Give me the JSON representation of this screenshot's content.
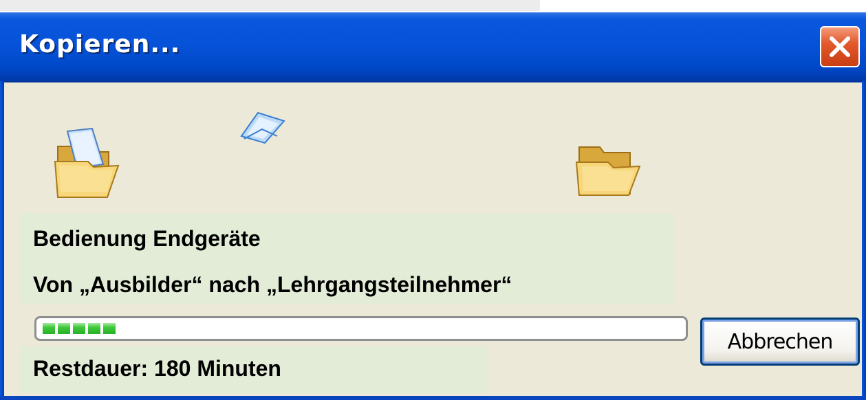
{
  "window": {
    "title": "Kopieren...",
    "close_icon": "close-icon"
  },
  "animation": {
    "source_icon": "open-folder-with-document-icon",
    "flying_icon": "flying-document-icon",
    "target_icon": "open-folder-icon"
  },
  "file": {
    "name": "Bedienung Endgeräte",
    "route": "Von „Ausbilder“ nach „Lehrgangsteilnehmer“"
  },
  "progress": {
    "fraction": 0.15
  },
  "actions": {
    "cancel_label": "Abbrechen"
  },
  "status": {
    "remaining": "Restdauer: 180 Minuten"
  },
  "colors": {
    "titlebar": "#0653da",
    "dialog_bg": "#ece9d8",
    "highlight_box": "#e3ecd6",
    "progress_green": "#3ec83a",
    "close_red": "#e25a2e"
  }
}
